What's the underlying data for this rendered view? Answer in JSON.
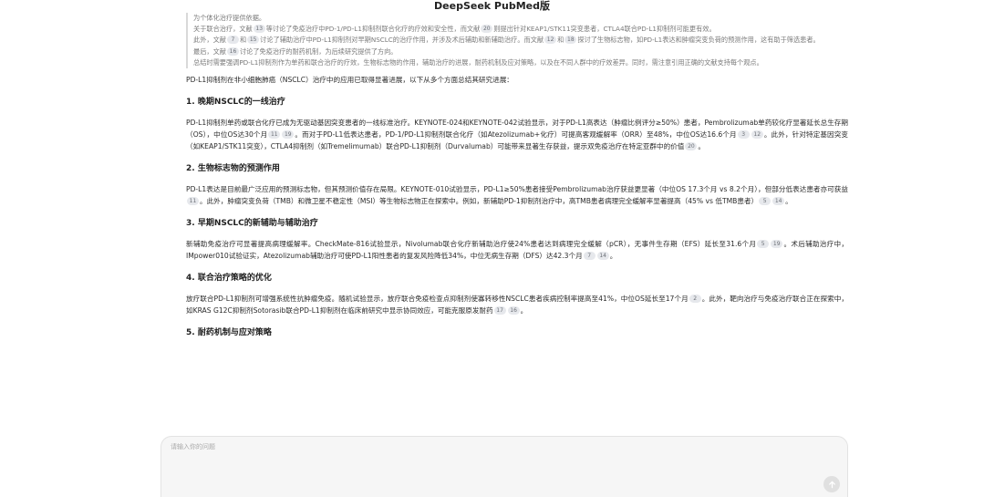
{
  "app": {
    "title": "DeepSeek PubMed版"
  },
  "quote": {
    "p1": "为个体化治疗提供依据。",
    "p2": [
      "关于联合治疗，文献",
      "等讨论了免疫治疗中PD-1/PD-L1抑制剂联合化疗的疗效和安全性，而文献",
      "则提出针对KEAP1/STK11突变患者，CTLA4联合PD-L1抑制剂可能更有效。"
    ],
    "p3": [
      "此外，文献",
      "和",
      "讨论了辅助治疗中PD-L1抑制剂对早期NSCLC的治疗作用，并涉及术后辅助和新辅助治疗。而文献",
      "和",
      "探讨了生物标志物，如PD-L1表达和肿瘤突变负荷的预测作用，这有助于筛选患者。"
    ],
    "p4": [
      "最后，文献",
      "讨论了免疫治疗的耐药机制，为后续研究提供了方向。"
    ],
    "p5": "总结时需要强调PD-L1抑制剂作为单药和联合治疗的疗效，生物标志物的作用，辅助治疗的进展，耐药机制及应对策略，以及在不同人群中的疗效差异。同时，需注意引用正确的文献支持每个观点。"
  },
  "answer": {
    "intro": "PD-L1抑制剂在非小细胞肺癌（NSCLC）治疗中的应用已取得显著进展，以下从多个方面总结其研究进展：",
    "sections": [
      {
        "title": "1. 晚期NSCLC的一线治疗",
        "text": [
          "PD-L1抑制剂单药或联合化疗已成为无驱动基因突变患者的一线标准治疗。KEYNOTE-024和KEYNOTE-042试验显示，对于PD-L1高表达（肿瘤比例评分≥50%）患者，Pembrolizumab单药较化疗显著延长总生存期（OS），中位OS达30个月",
          "。而对于PD-L1低表达患者，PD-1/PD-L1抑制剂联合化疗（如Atezolizumab+化疗）可提高客观缓解率（ORR）至48%，中位OS达16.6个月",
          "。此外，针对特定基因突变（如KEAP1/STK11突变），CTLA4抑制剂（如Tremelimumab）联合PD-L1抑制剂（Durvalumab）可能带来显著生存获益，提示双免疫治疗在特定亚群中的价值",
          "。"
        ]
      },
      {
        "title": "2. 生物标志物的预测作用",
        "text": [
          "PD-L1表达是目前最广泛应用的预测标志物，但其预测价值存在局限。KEYNOTE-010试验显示，PD-L1≥50%患者接受Pembrolizumab治疗获益更显著（中位OS 17.3个月 vs 8.2个月），但部分低表达患者亦可获益",
          "。此外，肿瘤突变负荷（TMB）和微卫星不稳定性（MSI）等生物标志物正在探索中。例如，新辅助PD-1抑制剂治疗中，高TMB患者病理完全缓解率显著提高（45% vs 低TMB患者）",
          "。"
        ]
      },
      {
        "title": "3. 早期NSCLC的新辅助与辅助治疗",
        "text": [
          "新辅助免疫治疗可显著提高病理缓解率。CheckMate-816试验显示，Nivolumab联合化疗新辅助治疗使24%患者达到病理完全缓解（pCR），无事件生存期（EFS）延长至31.6个月",
          "。术后辅助治疗中，IMpower010试验证实，Atezolizumab辅助治疗可使PD-L1阳性患者的复发风险降低34%，中位无病生存期（DFS）达42.3个月",
          "。"
        ]
      },
      {
        "title": "4. 联合治疗策略的优化",
        "text": [
          "放疗联合PD-L1抑制剂可增强系统性抗肿瘤免疫。随机试验显示，放疗联合免疫检查点抑制剂使寡转移性NSCLC患者疾病控制率提高至41%，中位OS延长至17个月",
          "。此外，靶向治疗与免疫治疗联合正在探索中，如KRAS G12C抑制剂Sotorasib联合PD-L1抑制剂在临床前研究中显示协同效应，可能克服原发耐药",
          "。"
        ]
      },
      {
        "title": "5. 耐药机制与应对策略",
        "text": []
      }
    ]
  },
  "input": {
    "placeholder": "请输入你的问题"
  },
  "icons": {
    "send": "arrow-up-icon"
  }
}
